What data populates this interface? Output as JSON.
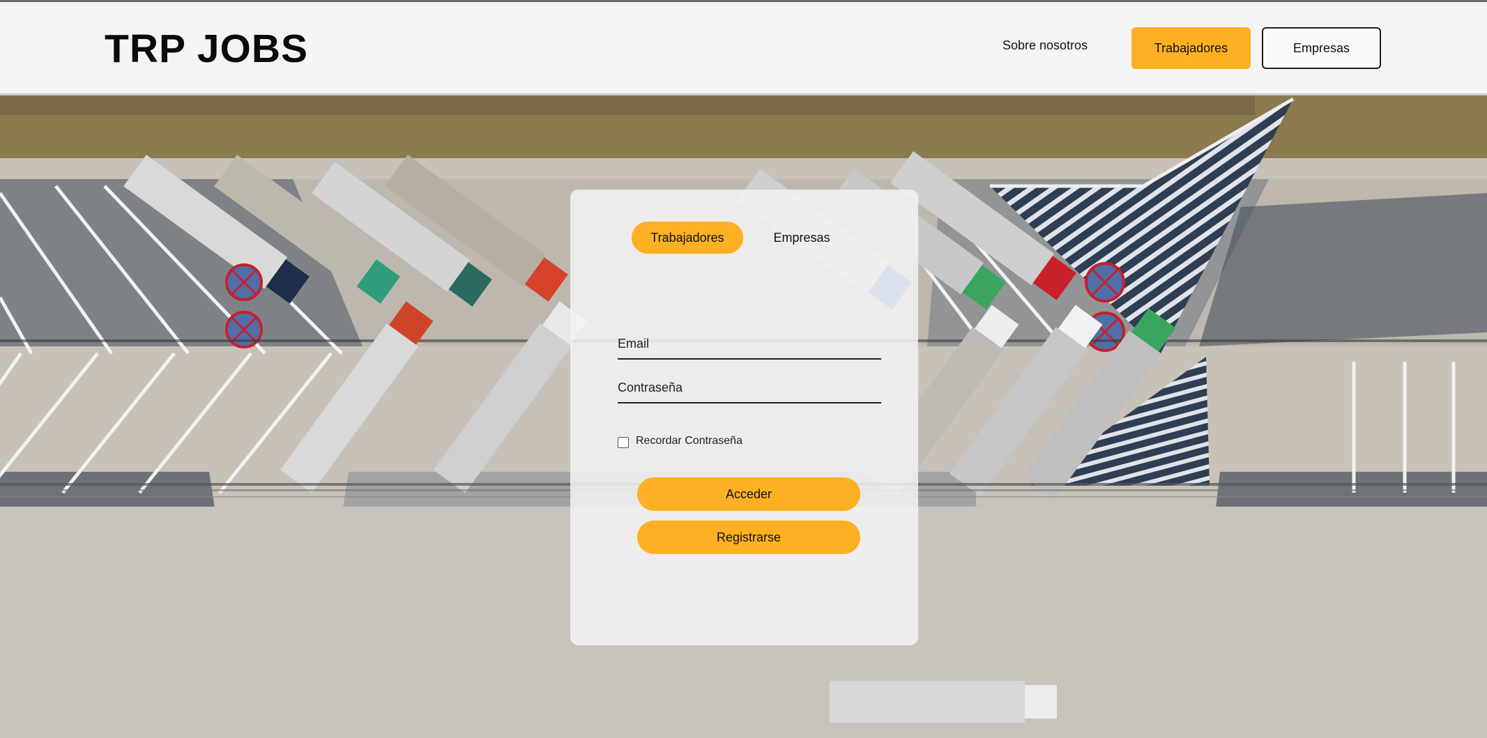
{
  "header": {
    "logo": "TRP JOBS",
    "nav": {
      "about": "Sobre nosotros",
      "workers": "Trabajadores",
      "companies": "Empresas"
    }
  },
  "login": {
    "tabs": [
      {
        "label": "Trabajadores",
        "active": true
      },
      {
        "label": "Empresas",
        "active": false
      }
    ],
    "email": {
      "placeholder": "Email",
      "value": ""
    },
    "password": {
      "placeholder": "Contraseña",
      "value": ""
    },
    "remember_label": "Recordar Contraseña",
    "remember_checked": false,
    "submit_label": "Acceder",
    "register_label": "Registrarse"
  },
  "colors": {
    "accent": "#fdb022",
    "header_bg": "#f5f5f5",
    "field_underline": "#1c1f3b"
  }
}
